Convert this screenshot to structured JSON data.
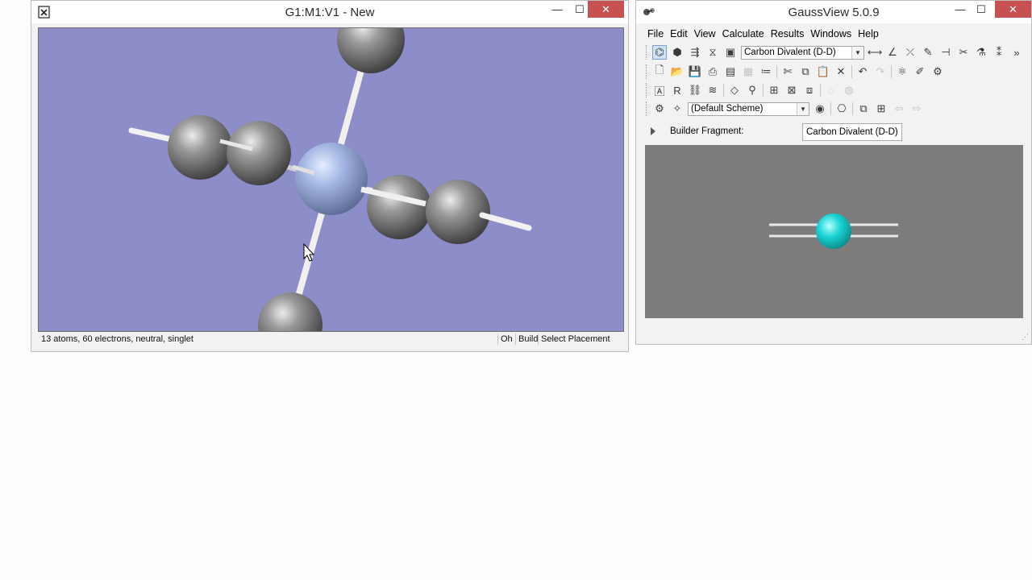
{
  "viewer": {
    "title": "G1:M1:V1 - New",
    "status_text": "13 atoms, 60 electrons, neutral, singlet",
    "status_fields": [
      "Oh",
      "Build",
      "Select Placement"
    ],
    "viewport_color": "#8d8dca"
  },
  "main": {
    "title": "GaussView 5.0.9",
    "menu": [
      "File",
      "Edit",
      "View",
      "Calculate",
      "Results",
      "Windows",
      "Help"
    ],
    "fragment_combo": "Carbon Divalent (D-D)",
    "scheme_combo": "(Default Scheme)",
    "builder_label": "Builder Fragment:",
    "builder_fragment": "Carbon Divalent (D-D)",
    "preview_color": "#7c7c7c",
    "atom_color": "#19d4d4"
  }
}
